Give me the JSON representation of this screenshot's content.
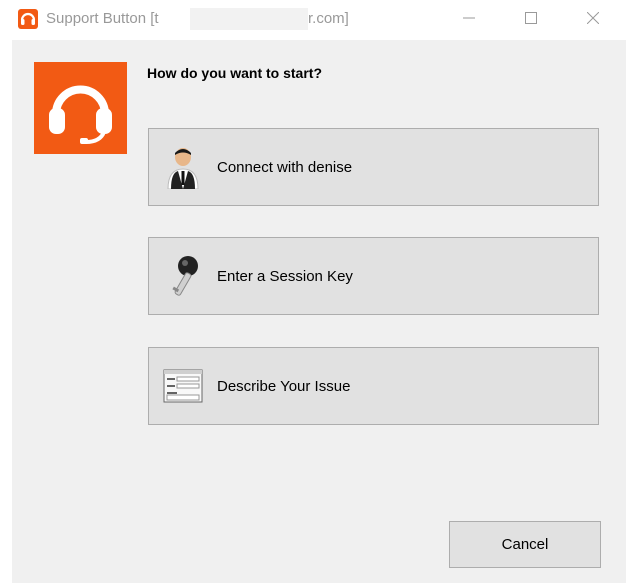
{
  "window": {
    "title_prefix": "Support Button [t",
    "title_suffix": "r.com]",
    "controls": {
      "minimize_icon": "minimize-icon",
      "maximize_icon": "maximize-icon",
      "close_icon": "close-icon"
    }
  },
  "colors": {
    "brand": "#f25a14",
    "window_bg": "#f0f0f0",
    "button_bg": "#e1e1e1",
    "button_border": "#adadad"
  },
  "main": {
    "heading": "How do you want to start?",
    "options": [
      {
        "label": "Connect with denise",
        "icon": "person-icon"
      },
      {
        "label": "Enter a Session Key",
        "icon": "key-icon"
      },
      {
        "label": "Describe Your Issue",
        "icon": "form-icon"
      }
    ]
  },
  "footer": {
    "cancel_label": "Cancel"
  }
}
